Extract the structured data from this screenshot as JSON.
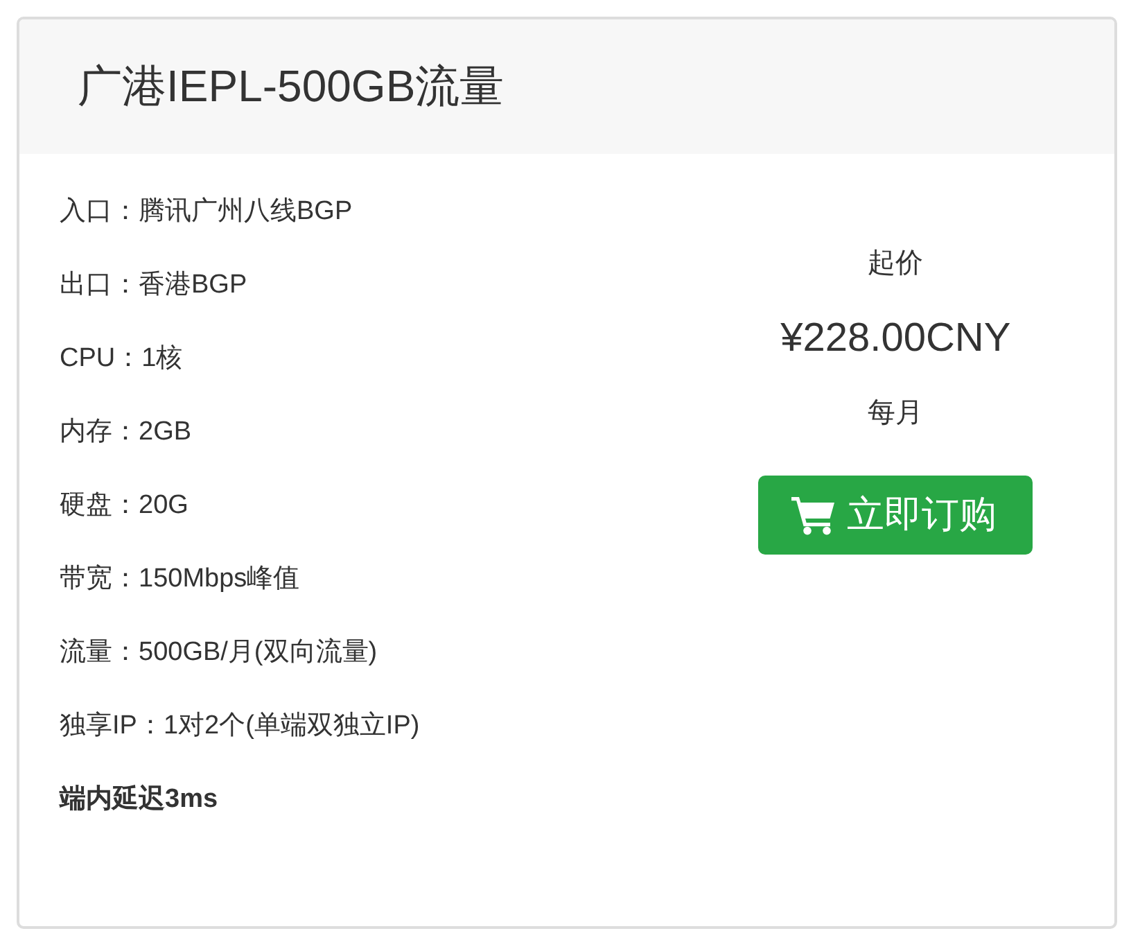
{
  "card": {
    "title": "广港IEPL-500GB流量"
  },
  "features": [
    {
      "text": "入口：腾讯广州八线BGP",
      "bold": false
    },
    {
      "text": "出口：香港BGP",
      "bold": false
    },
    {
      "text": "CPU：1核",
      "bold": false
    },
    {
      "text": "内存：2GB",
      "bold": false
    },
    {
      "text": "硬盘：20G",
      "bold": false
    },
    {
      "text": "带宽：150Mbps峰值",
      "bold": false
    },
    {
      "text": "流量：500GB/月(双向流量)",
      "bold": false
    },
    {
      "text": "独享IP：1对2个(单端双独立IP)",
      "bold": false
    },
    {
      "text": "端内延迟3ms",
      "bold": true
    }
  ],
  "pricing": {
    "label": "起价",
    "price": "¥228.00CNY",
    "period": "每月"
  },
  "order_button": {
    "label": "立即订购"
  }
}
